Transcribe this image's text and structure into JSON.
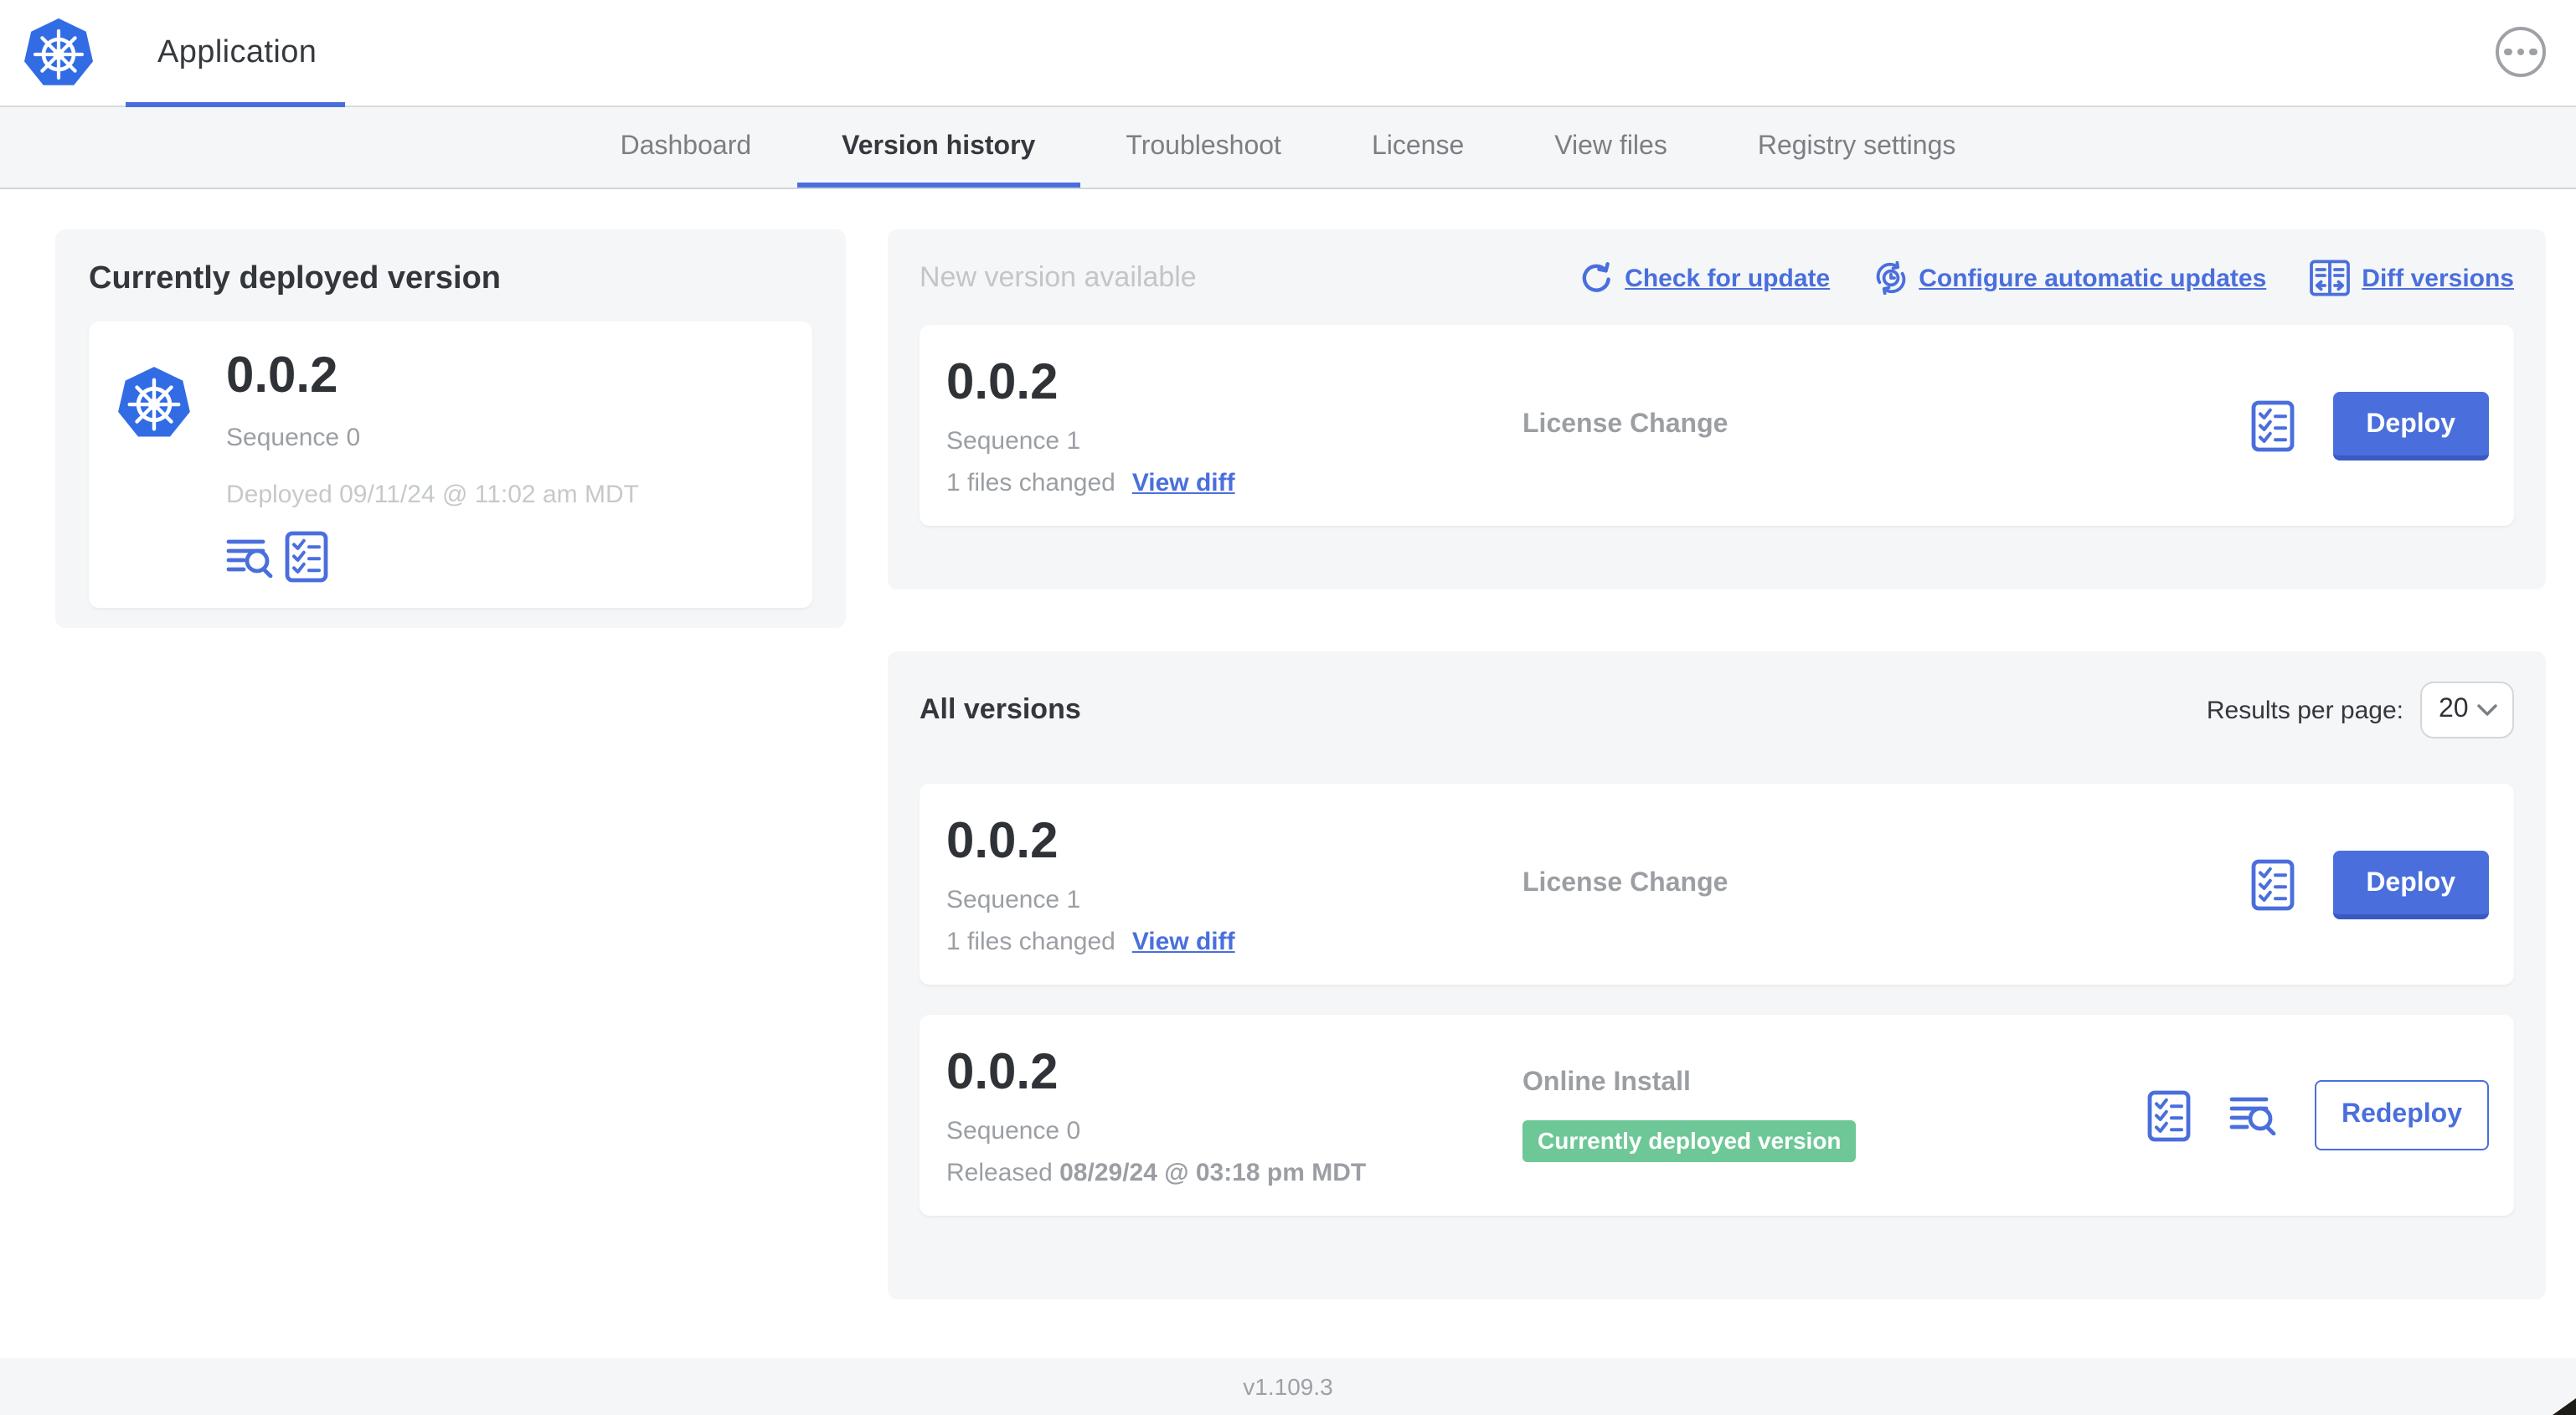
{
  "header": {
    "title": "Application"
  },
  "nav": {
    "active_tab": "Version history",
    "tabs": [
      {
        "label": "Dashboard"
      },
      {
        "label": "Version history"
      },
      {
        "label": "Troubleshoot"
      },
      {
        "label": "License"
      },
      {
        "label": "View files"
      },
      {
        "label": "Registry settings"
      }
    ]
  },
  "current": {
    "heading": "Currently deployed version",
    "version": "0.0.2",
    "sequence": "Sequence 0",
    "deployed": "Deployed 09/11/24 @ 11:02 am MDT"
  },
  "new_version": {
    "heading": "New version available",
    "actions": {
      "check": "Check for update",
      "configure": "Configure automatic updates",
      "diff": "Diff versions"
    },
    "row": {
      "version": "0.0.2",
      "sequence": "Sequence 1",
      "files_changed": "1 files changed",
      "view_diff": "View diff",
      "type": "License Change",
      "action": "Deploy"
    }
  },
  "all_versions": {
    "heading": "All versions",
    "results_per_page_label": "Results per page:",
    "results_per_page": "20",
    "rows": [
      {
        "version": "0.0.2",
        "sequence": "Sequence 1",
        "files_changed": "1 files changed",
        "view_diff": "View diff",
        "type": "License Change",
        "action": "Deploy"
      },
      {
        "version": "0.0.2",
        "sequence": "Sequence 0",
        "released_prefix": "Released",
        "released_date": "08/29/24 @ 03:18 pm MDT",
        "type": "Online Install",
        "badge": "Currently deployed version",
        "action": "Redeploy"
      }
    ]
  },
  "footer": {
    "app_version": "v1.109.3"
  },
  "icons": {
    "app_logo": "kubernetes-logo",
    "menu": "ellipsis-icon",
    "check_update": "refresh-icon",
    "configure_updates": "clock-refresh-icon",
    "diff_versions": "diff-icon",
    "preflight": "checklist-icon",
    "logs": "logs-magnifier-icon",
    "select": "chevron-down-icon"
  },
  "colors": {
    "accent_blue": "#4a6fdc",
    "kubernetes_blue": "#326ce5",
    "badge_green": "#6ec797",
    "panel_gray": "#f4f6f8",
    "text_dark": "#33373c",
    "text_gray": "#9b9fa4",
    "text_light": "#c6c9cc"
  }
}
